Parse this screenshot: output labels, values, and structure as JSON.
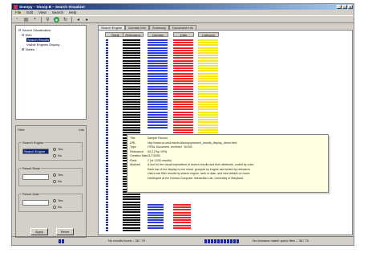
{
  "window": {
    "title": "Snoopy – Snoop B – Search Visualizer",
    "controls": [
      "_",
      "□",
      "×"
    ]
  },
  "menu": [
    "File",
    "Edit",
    "View",
    "Search",
    "Help"
  ],
  "toolbar": {
    "icons": [
      "new-icon",
      "open-icon",
      "save-icon",
      "search-icon",
      "globe-icon",
      "refresh-icon",
      "back-icon",
      "forward-icon"
    ]
  },
  "tree": {
    "root": "Search Visualization",
    "folder": "Web",
    "items": [
      "Search Results",
      "Visible Engines Display"
    ],
    "other": "Tables"
  },
  "panel": {
    "title": "Filter",
    "right_label": "Info",
    "groups": [
      {
        "label": "Search Engine",
        "value": "Search Engine",
        "selected": true,
        "opt1": "Yes",
        "opt2": "No"
      },
      {
        "label": "Result Rank",
        "value": "",
        "selected": false,
        "opt1": "Yes",
        "opt2": "No"
      },
      {
        "label": "Result Date",
        "value": "",
        "selected": false,
        "opt1": "Yes",
        "opt2": "No"
      }
    ],
    "apply": "Apply",
    "reset": "Reset"
  },
  "tabs": [
    "Search Engine",
    "Domain Info",
    "Summary",
    "Document Info"
  ],
  "grid": {
    "headers": [
      "Rank",
      "Relevance",
      "Domain",
      "Date",
      "Category"
    ],
    "colors": {
      "rank": "#1c2a9e",
      "black": "#111111",
      "blue": "#2b3ed8",
      "red": "#ee2222",
      "yellow": "#f8e81a"
    },
    "rank_rows": 75,
    "black_rows": 75,
    "blue_rows": 35,
    "red_rows": 38,
    "yellow_rows": 37,
    "tail_blue": 10,
    "tail_red": 10
  },
  "tooltip": {
    "rows": [
      {
        "k": "Title",
        "v": "Sample Record"
      },
      {
        "k": "URL",
        "v": "http://www.cs.umd.edu/hcil/snoopy/search_results_display_demo.html"
      },
      {
        "k": "Type",
        "v": "HTML Document, text/html · 84 KB"
      },
      {
        "k": "Relevance",
        "v": "94.3 (Top 10%)"
      },
      {
        "k": "Creation Date",
        "v": "11/7/2000"
      },
      {
        "k": "Rank",
        "v": "2 (of 1,000 results)"
      },
      {
        "k": "Abstract",
        "v": "A tool for the visual exploration of search results and their attributes, coded by color."
      },
      {
        "k": "",
        "v": "Each bar of the display is one result, grouped by engine and sorted by relevance."
      },
      {
        "k": "",
        "v": "Users can filter results by search engine, rank or date, and view details on hover."
      },
      {
        "k": "",
        "v": "Developed at the Human-Computer Interaction Lab, University of Maryland."
      }
    ]
  },
  "status": {
    "left_text": "No results found – 38 / 75",
    "right_text": "No domains match query filter – 38 / 75",
    "left_segments": 2,
    "right_segments": 11
  }
}
